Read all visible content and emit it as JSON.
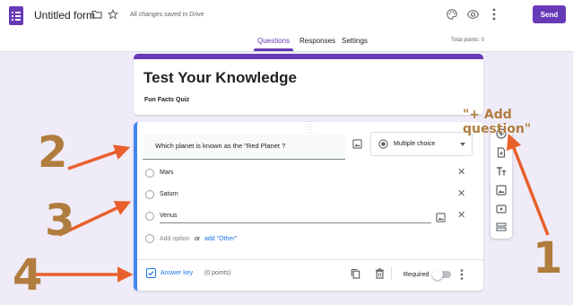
{
  "header": {
    "form_title": "Untitled form",
    "save_status": "All changes saved in Drive",
    "send_label": "Send",
    "tabs": [
      {
        "label": "Questions"
      },
      {
        "label": "Responses"
      },
      {
        "label": "Settings"
      }
    ],
    "total_points": "Total points: 0"
  },
  "title_card": {
    "title": "Test Your Knowledge",
    "subtitle": "Fun Facts Quiz"
  },
  "question": {
    "text": "Which planet is known as the \"Red Planet ?",
    "type": "Multiple choice",
    "options": [
      {
        "label": "Mars"
      },
      {
        "label": "Saturn"
      },
      {
        "label": "Venus"
      }
    ],
    "add_option": "Add option",
    "or": "or",
    "add_other": "add \"Other\"",
    "answer_key": "Answer key",
    "points": "(0 points)",
    "required_label": "Required",
    "required": false
  },
  "annotations": {
    "add_question": "\"+ Add question\"",
    "n1": "1",
    "n2": "2",
    "n3": "3",
    "n4": "4"
  },
  "colors": {
    "accent": "#673ab7",
    "background": "#f0ebf8",
    "link": "#1a73e8",
    "arrow": "#e8602c",
    "annotation": "#b07d3e"
  }
}
